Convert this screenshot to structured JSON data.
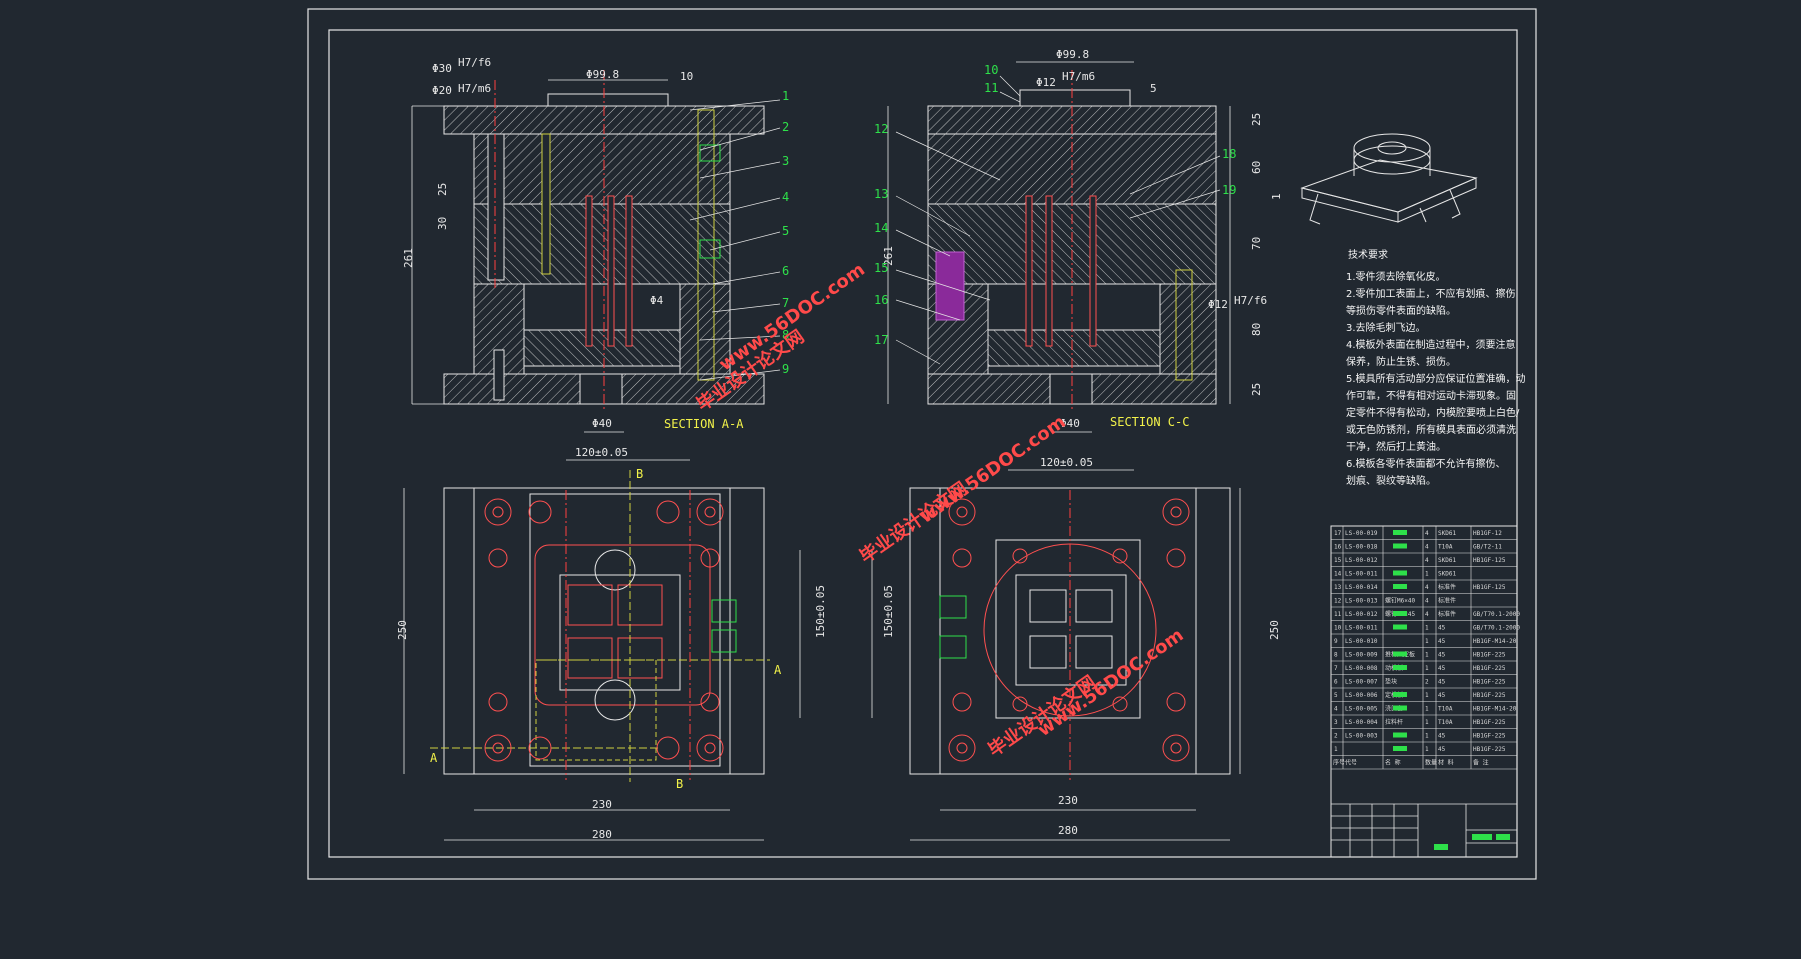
{
  "section_aa": {
    "title": "SECTION A-A",
    "dims": {
      "d30": "Φ30",
      "d20": "Φ20",
      "fit1": "H7/f6",
      "fit2": "H7/m6",
      "top_width": "Φ99.8",
      "top_h": "10",
      "d40": "Φ40",
      "height": "261",
      "h25": "25",
      "h30": "30",
      "pin": "Φ4"
    },
    "callouts": [
      "1",
      "2",
      "3",
      "4",
      "5",
      "6",
      "7",
      "8",
      "9"
    ]
  },
  "section_cc": {
    "title": "SECTION C-C",
    "dims": {
      "top_width": "Φ99.8",
      "d12": "Φ12",
      "fit": "H7/m6",
      "gap5": "5",
      "d40": "Φ40",
      "height": "261",
      "d12b": "Φ12",
      "fitb": "H7/f6",
      "h25a": "25",
      "h60": "60",
      "h70": "70",
      "h80": "80",
      "h25b": "25",
      "r1": "1"
    },
    "callouts": [
      "10",
      "11",
      "12",
      "13",
      "14",
      "15",
      "16",
      "17",
      "18",
      "19"
    ]
  },
  "plan_left": {
    "dims": {
      "top": "120±0.05",
      "side_h": "150±0.05",
      "height": "250",
      "inner_w": "230",
      "outer_w": "280"
    },
    "markers": {
      "b_top": "B",
      "b_bottom": "B",
      "a_right": "A",
      "a_left": "A"
    }
  },
  "plan_right": {
    "dims": {
      "top": "120±0.05",
      "side_h": "150±0.05",
      "height": "250",
      "inner_w": "230",
      "outer_w": "280"
    }
  },
  "requirements": {
    "heading": "技术要求",
    "lines": [
      "1.零件须去除氧化皮。",
      "2.零件加工表面上，不应有划痕、擦伤",
      "等损伤零件表面的缺陷。",
      "3.去除毛刺飞边。",
      "4.模板外表面在制造过程中，须要注意",
      "保养，防止生锈、损伤。",
      "5.模具所有活动部分应保证位置准确，动",
      "作可靠，不得有相对运动卡滞现象。固",
      "定零件不得有松动，内模腔要喷上白色/",
      "或无色防锈剂，所有模具表面必须清洗",
      "干净，然后打上黄油。",
      "6.模板各零件表面都不允许有擦伤、",
      "划痕、裂纹等缺陷。"
    ]
  },
  "bom": {
    "header": [
      "序号",
      "代号",
      "名 称",
      "数量",
      "材 料",
      "备 注"
    ],
    "rows": [
      [
        "",
        "LS-00-019",
        "",
        "4",
        "SKD61",
        "HB1GF-12"
      ],
      [
        "",
        "LS-00-018",
        "",
        "4",
        "T10A",
        "GB/T2-11"
      ],
      [
        "",
        "LS-00-012",
        "",
        "4",
        "SKD61",
        "HB1GF-125"
      ],
      [
        "",
        "LS-00-011",
        "",
        "1",
        "SKD61",
        ""
      ],
      [
        "",
        "LS-00-014",
        "",
        "4",
        "标准件",
        "HB1GF-125"
      ],
      [
        "",
        "LS-00-013",
        "螺钉M6×40",
        "4",
        "标准件",
        ""
      ],
      [
        "",
        "LS-00-012",
        "螺钉M8×45",
        "4",
        "标准件",
        "GB/T70.1-2000"
      ],
      [
        "",
        "LS-00-011",
        "",
        "1",
        "45",
        "GB/T70.1-2000"
      ],
      [
        "",
        "LS-00-010",
        "",
        "1",
        "45",
        "HB1GF-M14-20"
      ],
      [
        "",
        "LS-00-009",
        "推杆固定板",
        "1",
        "45",
        "HB1GF-225"
      ],
      [
        "",
        "LS-00-008",
        "动模板",
        "1",
        "45",
        "HB1GF-225"
      ],
      [
        "",
        "LS-00-007",
        "垫块",
        "2",
        "45",
        "HB1GF-225"
      ],
      [
        "",
        "LS-00-006",
        "定模板",
        "1",
        "45",
        "HB1GF-225"
      ],
      [
        "",
        "LS-00-005",
        "浇口套",
        "1",
        "T10A",
        "HB1GF-M14-20"
      ],
      [
        "",
        "LS-00-004",
        "拉料杆",
        "1",
        "T10A",
        "HB1GF-225"
      ],
      [
        "",
        "LS-00-003",
        "",
        "1",
        "45",
        "HB1GF-225"
      ],
      [
        "",
        "",
        "",
        "1",
        "45",
        "HB1GF-225"
      ]
    ]
  },
  "watermarks": [
    "毕业设计论文网",
    "www.56DOC.com"
  ]
}
